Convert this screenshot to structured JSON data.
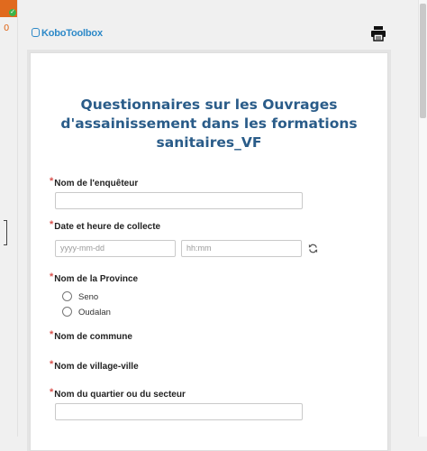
{
  "sidebar": {
    "count": "0"
  },
  "header": {
    "logo_text": "KoboToolbox",
    "print_icon": "printer-icon"
  },
  "form": {
    "title": "Questionnaires sur les Ouvrages d'assainissement dans les formations sanitaires_VF",
    "required_mark": "*",
    "questions": [
      {
        "label": "Nom de l'enquêteur"
      },
      {
        "label": "Date et heure de collecte",
        "date_placeholder": "yyyy-mm-dd",
        "time_placeholder": "hh:mm"
      },
      {
        "label": "Nom de la Province",
        "options": [
          "Seno",
          "Oudalan"
        ]
      },
      {
        "label": "Nom de commune"
      },
      {
        "label": "Nom de village-ville"
      },
      {
        "label": "Nom du quartier ou du secteur"
      }
    ]
  },
  "colors": {
    "accent": "#2d89c8",
    "title": "#2a5c89",
    "required": "#d9534f"
  }
}
